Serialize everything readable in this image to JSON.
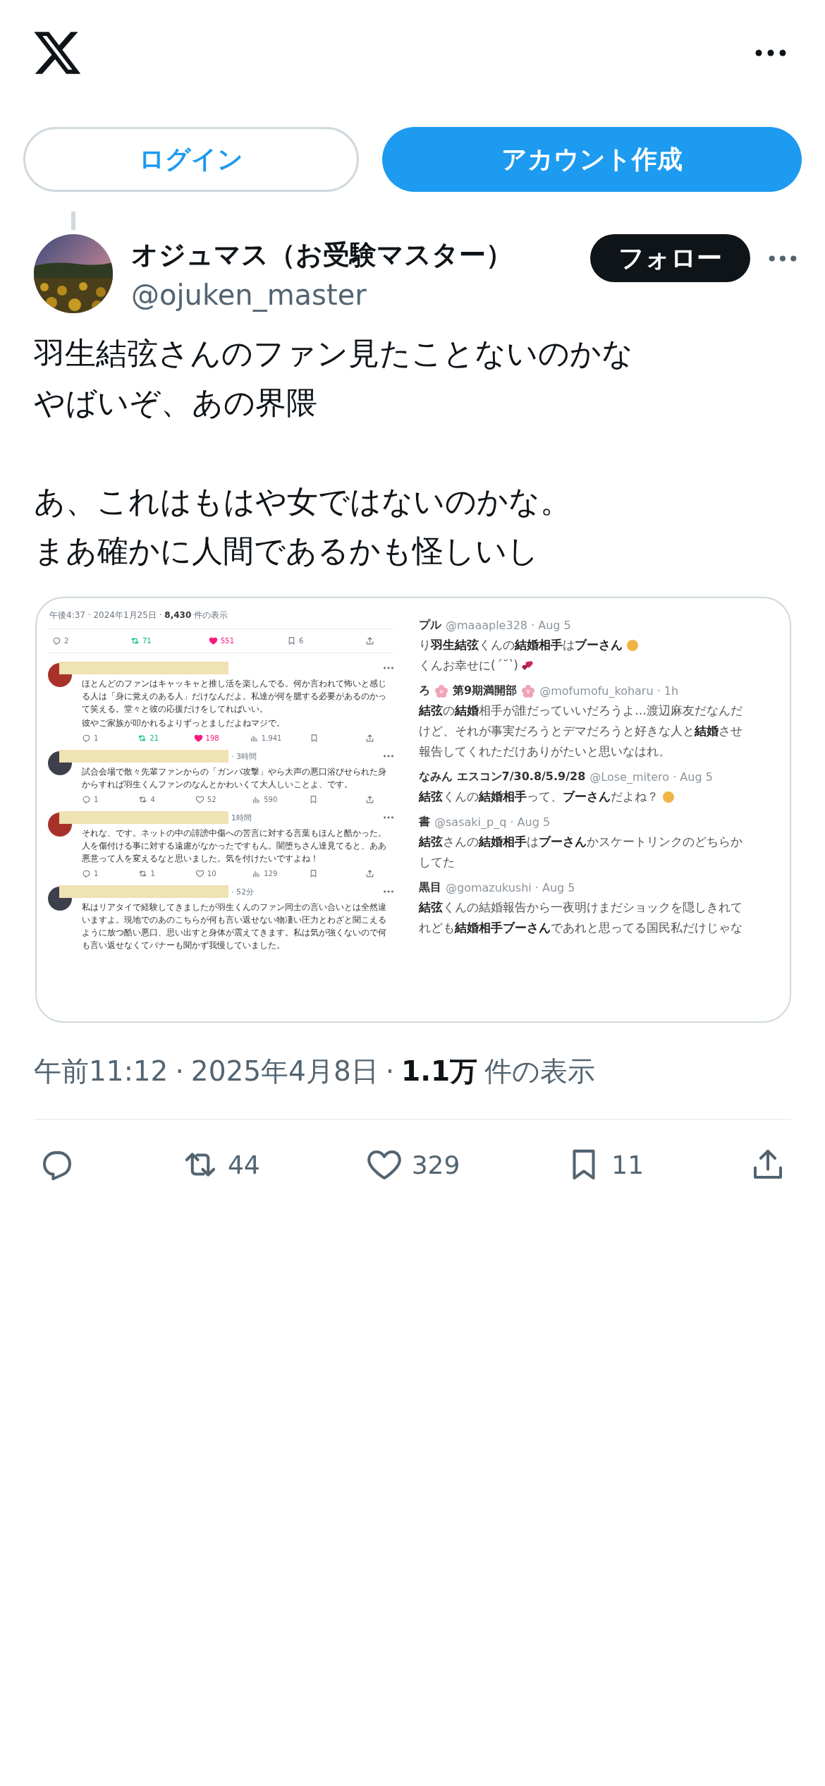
{
  "auth_buttons": [
    {
      "kind": "outline",
      "label": "ログイン"
    },
    {
      "kind": "filled",
      "label": "アカウント作成"
    }
  ],
  "tweet": {
    "author": {
      "name": "オジュマス（お受験マスター）",
      "handle": "@ojuken_master"
    },
    "follow_button": "フォロー",
    "paragraphs": [
      [
        "羽生結弦さんのファン見たことないのかな",
        "やばいぞ、あの界隈"
      ],
      [
        "あ、これはもはや女ではないのかな。",
        "まあ確かに人間であるかも怪しいし"
      ]
    ],
    "media": {
      "left": {
        "timestamp": "午後4:37 · 2024年1月25日 · **8,430** 件の表示",
        "stats": [
          {
            "kind": "reply",
            "count": "2",
            "on": false
          },
          {
            "kind": "repost",
            "count": "71",
            "on": true
          },
          {
            "kind": "like",
            "count": "551",
            "on": true
          },
          {
            "kind": "bookmark",
            "count": "6",
            "on": false
          },
          {
            "kind": "share",
            "on": false
          }
        ],
        "replies": [
          {
            "color": "#a8322a",
            "text": [
              "ほとんどのファンはキャッキャと推し活を楽しんでる。何か言われて怖いと感じる人は「身に覚えのある人」だけなんだよ。私達が何を臆する必要があるのかって笑える。堂々と彼の応援だけをしてればいい。",
              "彼やご家族が叩かれるよりずっとましだよねマジで。"
            ],
            "stats": [
              {
                "kind": "reply",
                "count": "1",
                "on": false
              },
              {
                "kind": "repost",
                "count": "21",
                "on": true
              },
              {
                "kind": "like",
                "count": "198",
                "on": true
              },
              {
                "kind": "views",
                "count": "1,941",
                "on": false
              },
              {
                "kind": "bookmark",
                "on": false
              },
              {
                "kind": "share",
                "on": false
              }
            ]
          },
          {
            "color": "#3d3f4a",
            "time": "· 3時間",
            "text": [
              "試合会場で散々先輩ファンからの「ガンバ攻撃」やら大声の悪口浴びせられた身からすれば羽生くんファンのなんとかわいくて大人しいことよ、です。"
            ],
            "stats": [
              {
                "kind": "reply",
                "count": "1",
                "on": false
              },
              {
                "kind": "repost",
                "count": "4",
                "on": false
              },
              {
                "kind": "like",
                "count": "52",
                "on": false
              },
              {
                "kind": "views",
                "count": "590",
                "on": false
              },
              {
                "kind": "bookmark",
                "on": false
              },
              {
                "kind": "share",
                "on": false
              }
            ]
          },
          {
            "color": "#a8322a",
            "time": "1時間",
            "text": [
              "それな、です。ネットの中の誹謗中傷への苦言に対する言葉もほんと酷かった。人を傷付ける事に対する遠慮がなかったですもん。闇堕ちさん達見てると、ああ悪意って人を変えるなと思いました。気を付けたいですよね！"
            ],
            "stats": [
              {
                "kind": "reply",
                "count": "1",
                "on": false
              },
              {
                "kind": "repost",
                "count": "1",
                "on": false
              },
              {
                "kind": "like",
                "count": "10",
                "on": false
              },
              {
                "kind": "views",
                "count": "129",
                "on": false
              },
              {
                "kind": "bookmark",
                "on": false
              },
              {
                "kind": "share",
                "on": false
              }
            ]
          },
          {
            "color": "#3d3f4a",
            "time": "· 52分",
            "text": [
              "私はリアタイで経験してきましたが羽生くんのファン同士の言い合いとは全然違いますよ。現地でのあのこちらが何も言い返せない物凄い圧力とわざと聞こえるように放つ酷い悪口、思い出すと身体が震えてきます。私は気が強くないので何も言い返せなくてバナーも聞かず我慢していました。"
            ]
          }
        ]
      },
      "right": {
        "posts": [
          {
            "name": [
              {
                "kind": "text",
                "text": "プル"
              }
            ],
            "handle": "@maaaple328 · Aug 5",
            "lines": [
              {
                "kind": "face",
                "text": "り**羽生結弦**くんの**結婚相手**は**ブーさん**"
              },
              {
                "kind": "hearts",
                "text": "くんお幸せに(*´˘`*)"
              }
            ]
          },
          {
            "name": [
              {
                "kind": "text",
                "text": "ろ"
              },
              {
                "kind": "flower"
              },
              {
                "kind": "text",
                "text": "第9期満開部"
              },
              {
                "kind": "flower"
              }
            ],
            "handle": "@mofumofu_koharu · 1h",
            "lines": [
              {
                "kind": "plain",
                "text": "**結弦**の**結婚**相手が誰だっていいだろうよ…渡辺麻友だなんだ"
              },
              {
                "kind": "plain",
                "text": "けど、それが事実だろうとデマだろうと好きな人と**結婚**させ"
              },
              {
                "kind": "plain",
                "text": "報告してくれただけありがたいと思いなはれ。"
              }
            ]
          },
          {
            "name": [
              {
                "kind": "text",
                "text": "なみん エスコン7/30.8/5.9/28"
              }
            ],
            "handle": "@Lose_mitero · Aug 5",
            "lines": [
              {
                "kind": "face",
                "text": "**結弦**くんの**結婚相手**って、**ブーさん**だよね？"
              }
            ]
          },
          {
            "name": [
              {
                "kind": "text",
                "text": "書"
              }
            ],
            "handle": "@sasaki_p_q · Aug 5",
            "lines": [
              {
                "kind": "plain",
                "text": "**結弦**さんの**結婚相手**は**ブーさん**かスケートリンクのどちらか"
              },
              {
                "kind": "plain",
                "text": "してた"
              }
            ]
          },
          {
            "name": [
              {
                "kind": "text",
                "text": "黒目"
              }
            ],
            "handle": "@gomazukushi · Aug 5",
            "lines": [
              {
                "kind": "plain",
                "text": "**結弦**くんの結婚報告から一夜明けまだショックを隠しきれて"
              },
              {
                "kind": "plain",
                "text": "れども**結婚相手ブーさん**であれと思ってる国民私だけじゃな"
              }
            ]
          }
        ]
      }
    },
    "meta": {
      "time": "午前11:12",
      "separator_1": "·",
      "date": "2025年4月8日",
      "separator_2": "·",
      "views_count": "1.1万",
      "views_label": "件の表示"
    },
    "actions": [
      {
        "kind": "reply"
      },
      {
        "kind": "repost",
        "count": "44"
      },
      {
        "kind": "like",
        "count": "329"
      },
      {
        "kind": "bookmark",
        "count": "11"
      },
      {
        "kind": "share"
      }
    ]
  }
}
